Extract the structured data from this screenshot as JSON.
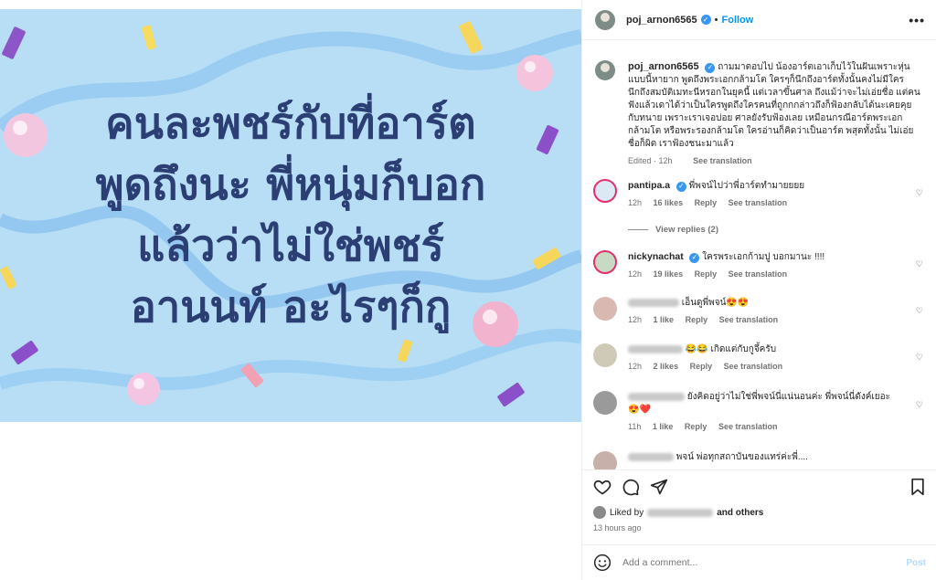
{
  "post": {
    "image_text_lines": [
      "คนละพชร์กับที่อาร์ต",
      "พูดถึงนะ พี่หนุ่มก็บอก",
      "แล้วว่าไม่ใช่พชร์",
      "อานนท์ อะไรๆก็กู"
    ]
  },
  "header": {
    "username": "poj_arnon6565",
    "separator": "•",
    "follow_label": "Follow",
    "more_label": "•••"
  },
  "caption": {
    "username": "poj_arnon6565",
    "text": "ถามมาตอบไป น้องอาร์ตเอาเก็บไว้ในฝันเพราะหุ่นแบบนี้หายาก พูดถึงพระเอกกล้ามโต ใครๆก็นึกถึงอาร์ตทั้งนั้นคงไม่มีใครนึกถึงสมบัติเมทะนีหรอกในยุคนี้ แต่เวลาขึ้นศาล ถึงแม้ว่าจะไม่เอ่ยชื่อ แต่คนฟังแล้วเดาได้ว่าเป็นใครพูดถึงใครคนที่ถูกกกล่าวถึงก็ฟ้องกลับได้นะเคยคุยกับทนาย เพราะเราเจอบ่อย ศาลยังรับฟ้องเลย เหมือนกรณีอาร์ตพระเอกกล้ามโต หรือพระรองกล้ามโต ใครอ่านก็คิดว่าเป็นอาร์ต พสุตทั้งนั้น ไม่เอ่ยชื่อก็ผิด เราฟ้องชนะมาแล้ว",
    "edited": "Edited",
    "time": "12h",
    "see_translation": "See translation"
  },
  "comments": [
    {
      "username": "pantipa.a",
      "verified": true,
      "text": "พี่พจน์ไปว่าพี่อาร์ตทำมายยยย",
      "time": "12h",
      "likes": "16 likes",
      "reply": "Reply",
      "translation": "See translation"
    },
    {
      "username": "nickynachat",
      "verified": true,
      "text": "ใครพระเอกก้ามปู บอกมานะ !!!!",
      "time": "12h",
      "likes": "19 likes",
      "reply": "Reply",
      "translation": "See translation"
    },
    {
      "username": "",
      "verified": false,
      "text": "เอ็นดูพี่พจน์😍😍",
      "time": "12h",
      "likes": "1 like",
      "reply": "Reply",
      "translation": "See translation"
    },
    {
      "username": "",
      "verified": false,
      "text": "😂😂 เกิดแต่กับกูจึ้ครับ",
      "time": "12h",
      "likes": "2 likes",
      "reply": "Reply",
      "translation": "See translation"
    },
    {
      "username": "",
      "verified": false,
      "text": "ยังคิดอยู่ว่าไม่ใช่พี่พจน์นี่แน่นอนค่ะ พี่พจน์นี่ดังค์เยอะ 😍❤️",
      "time": "11h",
      "likes": "1 like",
      "reply": "Reply",
      "translation": "See translation"
    },
    {
      "username": "",
      "verified": false,
      "text": "พจน์ พ่อทุกสถาบันของแทร่ค่ะพี่....",
      "time": "",
      "likes": "",
      "reply": "",
      "translation": ""
    }
  ],
  "view_replies": "View replies (2)",
  "likes": {
    "liked_by": "Liked by",
    "and_others": "and others",
    "time_ago": "13 hours ago"
  },
  "add_comment": {
    "placeholder": "Add a comment...",
    "post_label": "Post"
  },
  "icons": {
    "like": "heart-icon",
    "comment": "comment-icon",
    "share": "share-icon",
    "save": "bookmark-icon",
    "emoji": "emoji-icon"
  },
  "colors": {
    "accent": "#0095f6",
    "verified": "#3897f0",
    "image_bg": "#b7def4",
    "image_text": "#2c3f74"
  }
}
